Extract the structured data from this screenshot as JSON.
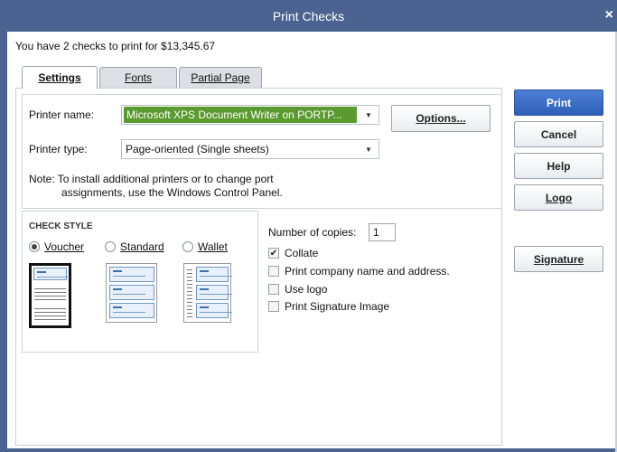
{
  "window": {
    "title": "Print Checks",
    "close_glyph": "×"
  },
  "summary": "You have 2 checks to print for $13,345.67",
  "tabs": [
    {
      "label": "Settings",
      "active": true
    },
    {
      "label": "Fonts",
      "active": false
    },
    {
      "label": "Partial Page",
      "active": false
    }
  ],
  "printer": {
    "name_label": "Printer name:",
    "name_value": "Microsoft XPS Document Writer on PORTP...",
    "type_label": "Printer type:",
    "type_value": "Page-oriented (Single sheets)",
    "options_label": "Options...",
    "note_line1": "Note: To install additional printers or to change port",
    "note_line2": "assignments, use the Windows Control Panel."
  },
  "check_style": {
    "caption": "CHECK STYLE",
    "options": [
      {
        "label": "Voucher",
        "selected": true
      },
      {
        "label": "Standard",
        "selected": false
      },
      {
        "label": "Wallet",
        "selected": false
      }
    ]
  },
  "copies": {
    "label": "Number of copies:",
    "value": "1"
  },
  "checkboxes": [
    {
      "label": "Collate",
      "checked": true
    },
    {
      "label": "Print company name and address.",
      "checked": false
    },
    {
      "label": "Use logo",
      "checked": false
    },
    {
      "label": "Print Signature Image",
      "checked": false
    }
  ],
  "buttons": {
    "print": "Print",
    "cancel": "Cancel",
    "help": "Help",
    "logo": "Logo",
    "signature": "Signature"
  },
  "colors": {
    "titlebar": "#4a6390",
    "primary_button": "#2f60b8",
    "selected_printer": "#5a9a2f"
  },
  "icons": {
    "close": "close-icon",
    "dropdown": "chevron-down-icon",
    "checkmark": "checkmark-icon"
  }
}
